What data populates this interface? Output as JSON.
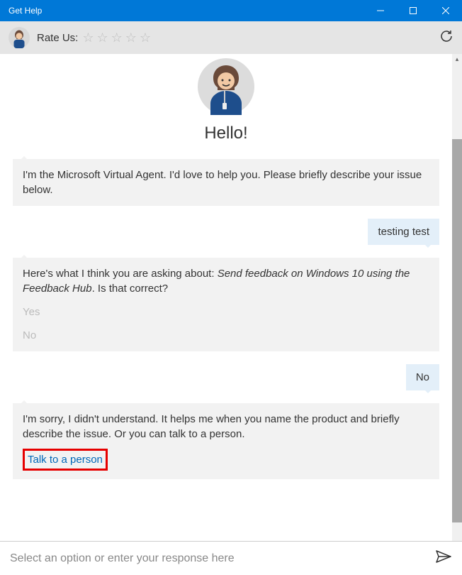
{
  "titlebar": {
    "title": "Get Help"
  },
  "subheader": {
    "rate_label": "Rate Us:"
  },
  "hero": {
    "greeting": "Hello!"
  },
  "messages": {
    "agent_intro": "I'm the Microsoft Virtual Agent. I'd love to help you. Please briefly describe your issue below.",
    "user_1": "testing test",
    "agent_guess_prefix": "Here's what I think you are asking about: ",
    "agent_guess_topic": "Send feedback on Windows 10 using the Feedback Hub",
    "agent_guess_suffix": ". Is that correct?",
    "option_yes": "Yes",
    "option_no": "No",
    "user_2": "No",
    "agent_sorry": "I'm sorry, I didn't understand. It helps me when you name the product and briefly describe the issue. Or you can talk to a person.",
    "talk_link": "Talk to a person"
  },
  "input": {
    "placeholder": "Select an option or enter your response here"
  }
}
